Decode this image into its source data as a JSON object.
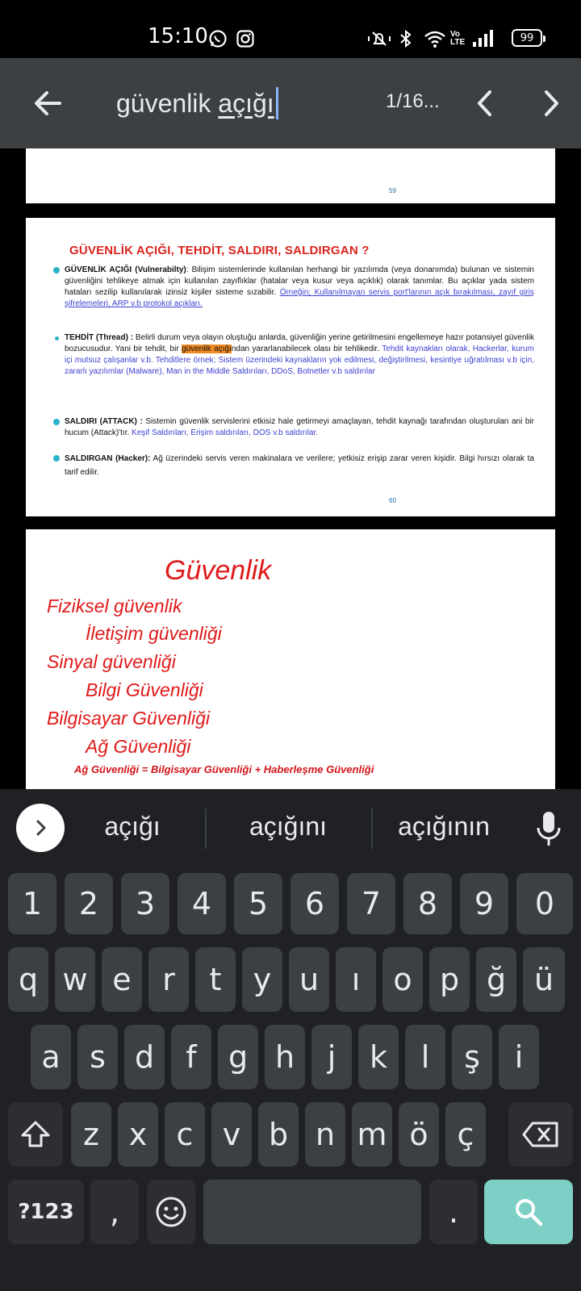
{
  "status_bar": {
    "time": "15:10",
    "battery": "99",
    "network": "Vo LTE",
    "icons": [
      "whatsapp-icon",
      "instagram-icon",
      "mute-icon",
      "bluetooth-icon",
      "wifi-icon",
      "signal-icon",
      "battery-icon"
    ]
  },
  "search": {
    "query_plain": "güvenlik ",
    "query_underlined": "açığı",
    "match_count": "1/16..."
  },
  "document": {
    "page1_number": "59",
    "page2": {
      "title": "GÜVENLİK AÇIĞI, TEHDİT, SALDIRI, SALDIRGAN ?",
      "b1_bold": "GÜVENLİK AÇIĞI (Vulnerabilty)",
      "b1_text": ": Bilişim sistemlerinde kullanılan herhangi bir yazılımda (veya donanımda) bulunan ve sistemin güvenliğini tehlikeye atmak için kullanılan zayıflıklar (hatalar veya kusur veya açıklık) olarak tanımlar. Bu açıklar yada sistem hataları sezilip kullanılarak izinsiz kişiler sisteme sızabilir.",
      "b1_example": "Örneğin; Kullanılmayan servis port'larının açık bırakılması, zayıf giriş şifrelemeleri, ARP v.b protokol açıkları.",
      "b2_bold": "TEHDİT (Thread) :",
      "b2_text_a": " Belirli durum veya olayın oluştuğu anlarda, güvenliğin yerine getirilmesini engellemeye hazır potansiyel güvenlik bozucusudur. Yani bir tehdit, bir ",
      "b2_highlight": "güvenlik açığı",
      "b2_text_b": "ndan yararlanabilecek olası bir tehlikedir.",
      "b2_blue": " Tehdit kaynakları olarak, Hackerlar, kurum içi mutsuz çalışanlar v.b. Tehditlere örnek; Sistem üzerindeki kaynakların yok edilmesi, değiştirilmesi, kesintiye uğratılması v.b için, zararlı yazılımlar (Malware), Man in the Middle Saldırıları, DDoS, Botnetler v.b saldırılar",
      "b3_bold": "SALDIRI (ATTACK) :",
      "b3_text": " Sistemin güvenlik servislerini etkisiz hale getirmeyi amaçlayan, tehdit kaynağı tarafından oluşturulan ani bir hucum (Attack)'tır.",
      "b3_blue": " Keşif Saldırıları, Erişim saldırıları, DOS v.b saldırılar.",
      "b4_bold": "SALDIRGAN (Hacker):",
      "b4_text": " Ağ üzerindeki servis veren makinalara ve verilere; yetkisiz erişip zarar veren kişidir. Bilgi hırsızı olarak ta tarif edilir.",
      "page_number": "60"
    },
    "page3": {
      "title": "Güvenlik",
      "lines": [
        "Fiziksel güvenlik",
        "İletişim güvenliği",
        "Sinyal güvenliği",
        "Bilgi Güvenliği",
        "Bilgisayar Güvenliği",
        "Ağ Güvenliği"
      ],
      "footer": "Ağ Güvenliği = Bilgisayar Güvenliği  +  Haberleşme Güvenliği"
    }
  },
  "suggestions": [
    "açığı",
    "açığını",
    "açığının"
  ],
  "keyboard": {
    "row_numbers": [
      "1",
      "2",
      "3",
      "4",
      "5",
      "6",
      "7",
      "8",
      "9",
      "0"
    ],
    "row1": [
      "q",
      "w",
      "e",
      "r",
      "t",
      "y",
      "u",
      "ı",
      "o",
      "p",
      "ğ",
      "ü"
    ],
    "row2": [
      "a",
      "s",
      "d",
      "f",
      "g",
      "h",
      "j",
      "k",
      "l",
      "ş",
      "i"
    ],
    "row3": [
      "z",
      "x",
      "c",
      "v",
      "b",
      "n",
      "m",
      "ö",
      "ç"
    ],
    "symbols_label": "?123",
    "comma": ",",
    "period": "."
  },
  "colors": {
    "toolbar_bg": "#3c4043",
    "keyboard_bg": "#202124",
    "key_bg": "#3c4043",
    "search_key": "#7ecfc5",
    "doc_red": "#e01a1a",
    "highlight": "#f08a24"
  }
}
